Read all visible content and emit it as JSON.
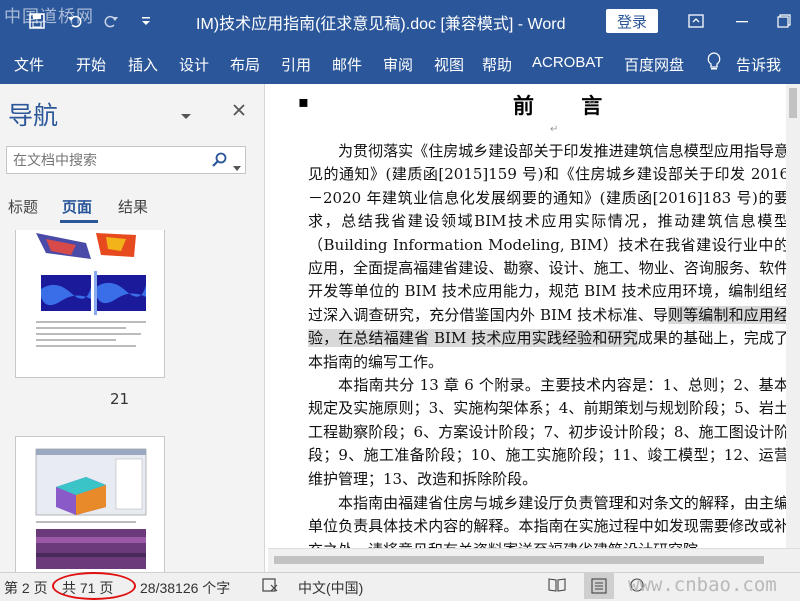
{
  "watermark_top": "中国道桥网",
  "title": "IM)技术应用指南(征求意见稿).doc [兼容模式] - Word",
  "login_label": "登录",
  "ribbon_tabs": [
    "文件",
    "开始",
    "插入",
    "设计",
    "布局",
    "引用",
    "邮件",
    "审阅",
    "视图",
    "帮助",
    "ACROBAT",
    "百度网盘"
  ],
  "tell_me": "告诉我",
  "nav": {
    "title": "导航",
    "search_placeholder": "在文档中搜索",
    "tabs": [
      "标题",
      "页面",
      "结果"
    ],
    "active_tab": "页面",
    "thumb_labels": [
      "21"
    ]
  },
  "doc": {
    "heading": "前 言",
    "para1a": "为贯彻落实《住房城乡建设部关于印发推进建筑信息模型应用指导意见的通知》(建质函[2015]159 号)和《住房城乡建设部关于印发 2016－2020 年建筑业信息化发展纲要的通知》(建质函[2016]183 号)的要求，总结我省建设领域BIM技术应用实际情况，推动建筑信息模型（Building Information Modeling, BIM）技术在我省建设行业中的应用，全面提高福建省建设、勘察、设计、施工、物业、咨询服务、软件开发等单位的 BIM 技术应用能力，规范 BIM 技术应用环境，编制组经过深入调查研究，充分借鉴国内外 BIM 技术标准、导",
    "para1_hl": "则等编制和应用经验，在总结福建省 BIM 技术应用实践经验和研究",
    "para1b": "成果的基础上，完成了本指南的编写工作。",
    "para2": "本指南共分 13 章 6 个附录。主要技术内容是：1、总则；2、基本规定及实施原则；3、实施构架体系；4、前期策划与规划阶段；5、岩土工程勘察阶段；6、方案设计阶段；7、初步设计阶段；8、施工图设计阶段；9、施工准备阶段；10、施工实施阶段；11、竣工模型；12、运营维护管理；13、改造和拆除阶段。",
    "para3": "本指南由福建省住房与城乡建设厅负责管理和对条文的解释，由主编单位负责具体技术内容的解释。本指南在实施过程中如发现需要修改或补充之处，请将意见和有关资料寄送至福建省建筑设计研究院"
  },
  "status": {
    "page": "第 2 页",
    "total": "共 71 页",
    "words": "28/38126 个字",
    "lang": "中文(中国)"
  },
  "watermark_bottom": "www.cnbao.com",
  "colors": {
    "accent": "#2b579a",
    "highlight": "#d9d9d9",
    "circle": "#e01010"
  }
}
